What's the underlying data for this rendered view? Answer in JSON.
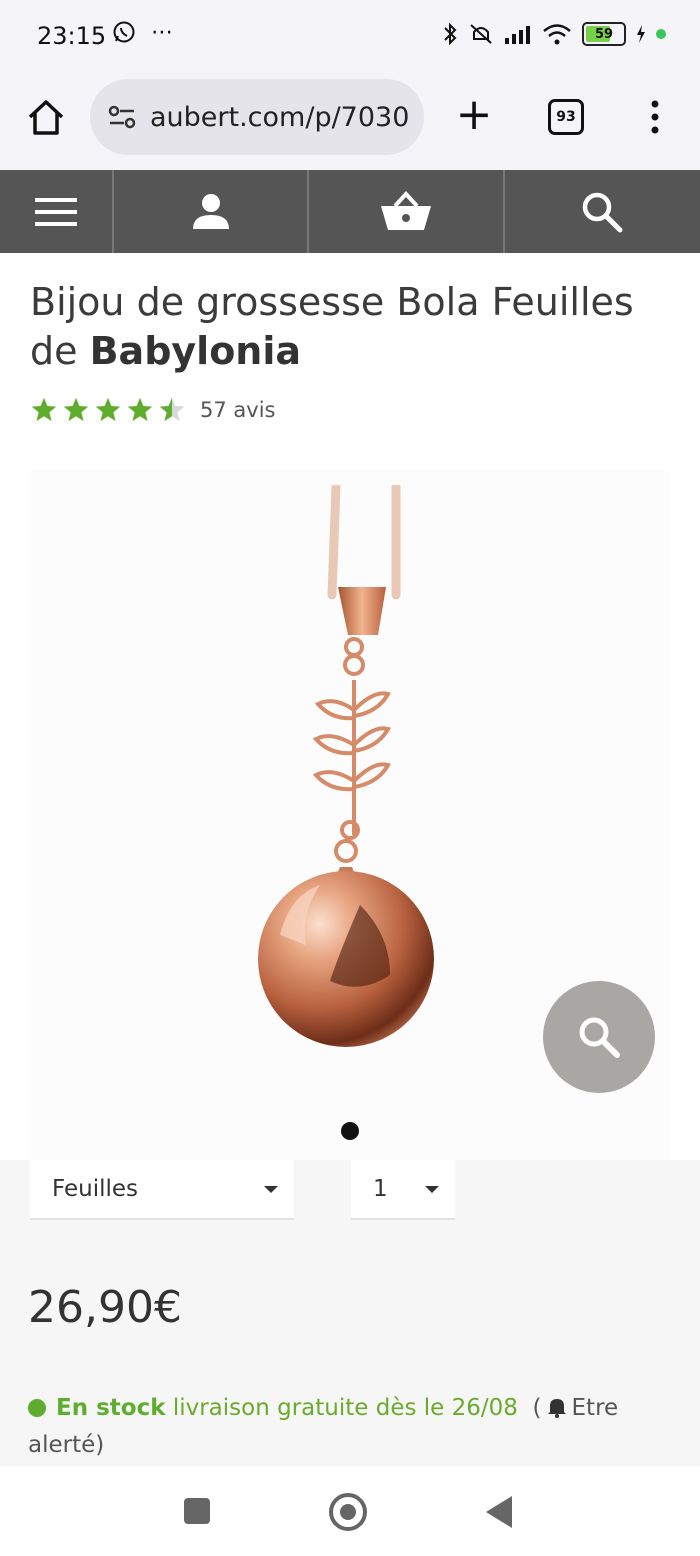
{
  "status_bar": {
    "time": "23:15",
    "left_extras": "⋯",
    "battery_level": "59",
    "icons": [
      "whatsapp-icon",
      "more-icon",
      "bluetooth-icon",
      "mute-icon",
      "signal-icon",
      "wifi-icon",
      "battery-icon",
      "charging-icon"
    ]
  },
  "browser": {
    "url": "aubert.com/p/7030",
    "tab_count": "93",
    "icons": [
      "home-icon",
      "site-settings-icon",
      "plus-icon",
      "tabs-icon",
      "kebab-menu-icon"
    ]
  },
  "site_nav": {
    "items": [
      "menu-icon",
      "account-icon",
      "basket-icon",
      "search-icon"
    ],
    "background": "#555555"
  },
  "product": {
    "title_prefix": "Bijou de grossesse Bola Feuilles de ",
    "brand": "Babylonia",
    "rating": 4.5,
    "rating_max": 5,
    "reviews": "57 avis",
    "image_alt_icon": "pendant-image",
    "carousel_count": 1,
    "carousel_active": 1,
    "variant": "Feuilles",
    "quantity": "1",
    "price": "26,90€",
    "stock_status": "En stock",
    "delivery_text": "livraison gratuite dès le 26/08",
    "alert_open": "(",
    "alert_text": "Etre alerté)"
  },
  "colors": {
    "accent_green": "#5fad2f",
    "star_green": "#5fad2f",
    "nav_gray": "#555555",
    "zoom_button": "#a8a7a3",
    "rose_gold": "#d58a68"
  }
}
